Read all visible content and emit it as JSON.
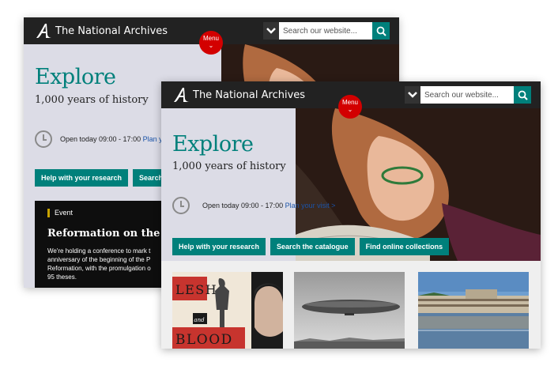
{
  "site": {
    "logo_text": "The National Archives",
    "menu_label": "Menu",
    "search_placeholder": "Search our website..."
  },
  "hero": {
    "title": "Explore",
    "subtitle": "1,000 years of history",
    "hours_text": "Open today 09:00 - 17:00",
    "plan_link_full": "Plan your visit >",
    "plan_link_cut": "Plan yo"
  },
  "buttons_front": [
    "Help with your research",
    "Search the catalogue",
    "Find online collections"
  ],
  "buttons_back": [
    "Help with your research",
    "Search the"
  ],
  "event": {
    "tag": "Event",
    "title": "Reformation on the rec",
    "text_lines": [
      "We're holding a conference to mark t",
      "anniversary of the beginning of the P",
      "Reformation, with the promulgation o",
      "95 theses."
    ]
  },
  "cards": {
    "flesh_blood": {
      "line1": "LESH",
      "line2": "and",
      "line3": "BLOOD"
    }
  },
  "colors": {
    "teal": "#00807b",
    "dark_bar": "#222222",
    "menu_red": "#d30000",
    "hero_bg": "#dcdce6",
    "event_tag_gold": "#c8a300"
  },
  "icons": {
    "logo": "tna-a-logo",
    "search": "search-icon",
    "dropdown": "chevron-down-icon",
    "clock": "clock-icon"
  }
}
